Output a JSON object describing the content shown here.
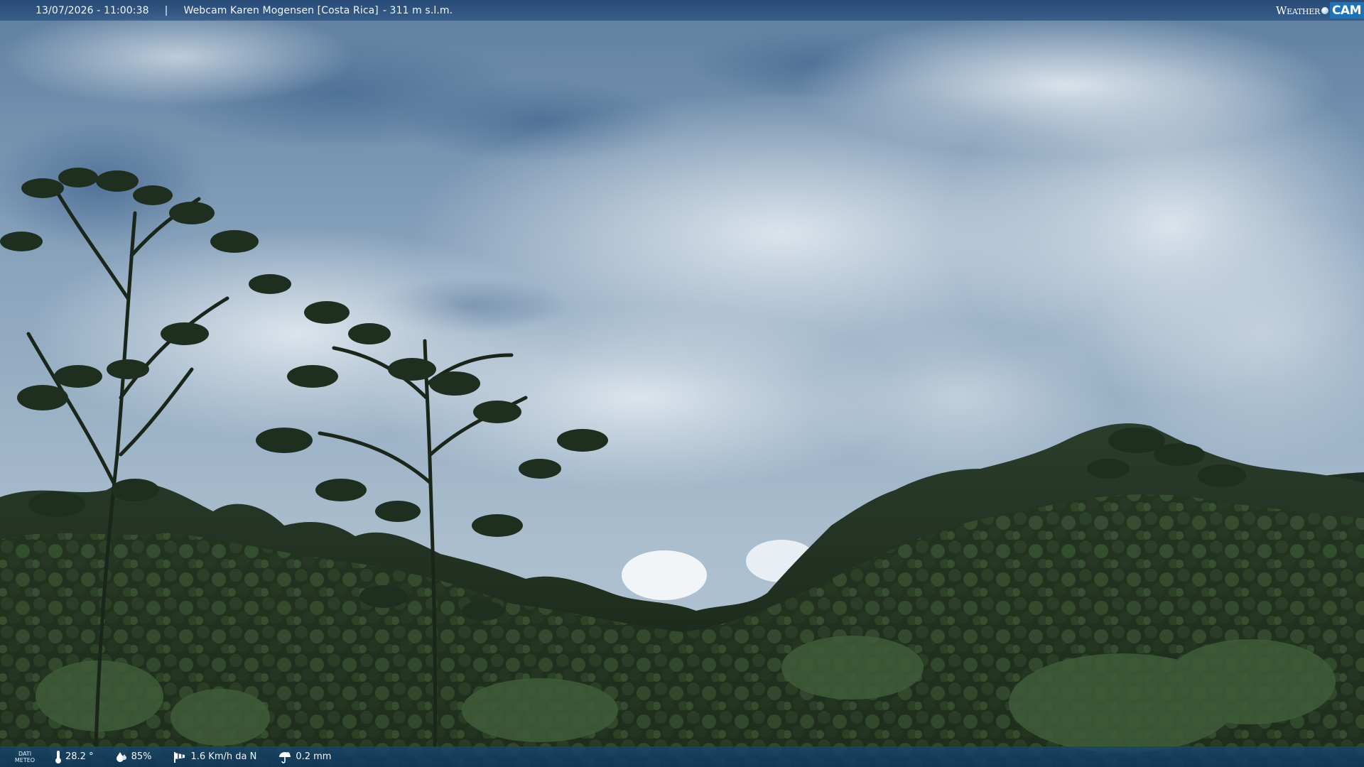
{
  "overlay": {
    "datetime": "13/07/2026 - 11:00:38",
    "separator": "|",
    "webcam_name": "Webcam Karen Mogensen [Costa Rica]",
    "altitude": "- 311 m s.l.m.",
    "brand": {
      "weather": "Weather",
      "cam": "CAM"
    }
  },
  "weather": {
    "label_line1": "DATI",
    "label_line2": "METEO",
    "temperature": "28.2 °",
    "humidity": "85%",
    "wind": "1.6 Km/h da N",
    "rain": "0.2 mm"
  },
  "colors": {
    "bar": "#1c406e",
    "brand_cam_bg": "#1d72b8",
    "sky": "#8ea7bf",
    "forest": "#1d2c1d"
  },
  "icons": {
    "temperature": "thermometer-icon",
    "humidity": "humidity-drop-icon",
    "wind": "windsock-icon",
    "rain": "umbrella-icon"
  }
}
